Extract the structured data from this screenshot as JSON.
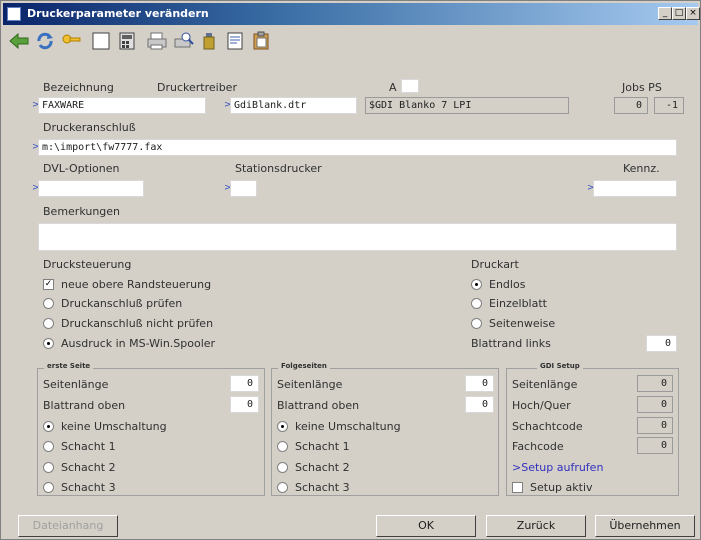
{
  "window": {
    "title": "Druckerparameter verändern"
  },
  "labels": {
    "bezeichnung": "Bezeichnung",
    "druckertreiber": "Druckertreiber",
    "a": "A",
    "jobs_ps": "Jobs PS",
    "druckeranschluss": "Druckeranschluß",
    "dvl_optionen": "DVL-Optionen",
    "stationsdrucker": "Stationsdrucker",
    "kennz": "Kennz.",
    "bemerkungen": "Bemerkungen",
    "drucksteuerung": "Drucksteuerung",
    "druckart": "Druckart",
    "blattrand_links": "Blattrand links"
  },
  "fields": {
    "bezeichnung": "FAXWARE",
    "druckertreiber": "GdiBlank.dtr",
    "treiber_name": "$GDI Blanko 7 LPI",
    "jobs": "0",
    "ps": "-1",
    "druckeranschluss": "m:\\import\\fw7777.fax",
    "dvl_optionen": "",
    "stationsdrucker": "",
    "kennz": "",
    "bemerkungen": "",
    "blattrand_links": "0"
  },
  "drucksteuerung": [
    {
      "type": "check",
      "label": "neue obere Randsteuerung",
      "checked": true
    },
    {
      "type": "radio",
      "label": "Druckanschluß prüfen",
      "checked": false
    },
    {
      "type": "radio",
      "label": "Druckanschluß nicht prüfen",
      "checked": false
    },
    {
      "type": "radio",
      "label": "Ausdruck in MS-Win.Spooler",
      "checked": true
    }
  ],
  "druckart": [
    {
      "label": "Endlos",
      "checked": true
    },
    {
      "label": "Einzelblatt",
      "checked": false
    },
    {
      "label": "Seitenweise",
      "checked": false
    }
  ],
  "erste_seite": {
    "title": "erste Seite",
    "seitenlaenge_label": "Seitenlänge",
    "seitenlaenge": "0",
    "blattrand_label": "Blattrand oben",
    "blattrand": "0",
    "options": [
      {
        "label": "keine Umschaltung",
        "checked": true
      },
      {
        "label": "Schacht 1",
        "checked": false
      },
      {
        "label": "Schacht 2",
        "checked": false
      },
      {
        "label": "Schacht 3",
        "checked": false
      }
    ]
  },
  "folgeseiten": {
    "title": "Folgeseiten",
    "seitenlaenge_label": "Seitenlänge",
    "seitenlaenge": "0",
    "blattrand_label": "Blattrand oben",
    "blattrand": "0",
    "options": [
      {
        "label": "keine Umschaltung",
        "checked": true
      },
      {
        "label": "Schacht 1",
        "checked": false
      },
      {
        "label": "Schacht 2",
        "checked": false
      },
      {
        "label": "Schacht 3",
        "checked": false
      }
    ]
  },
  "gdi_setup": {
    "title": "GDI Setup",
    "seitenlaenge_label": "Seitenlänge",
    "seitenlaenge": "0",
    "hochquer_label": "Hoch/Quer",
    "hochquer": "0",
    "schachtcode_label": "Schachtcode",
    "schachtcode": "0",
    "fachcode_label": "Fachcode",
    "fachcode": "0",
    "setup_link": ">Setup aufrufen",
    "setup_aktiv_label": "Setup aktiv",
    "setup_aktiv": false
  },
  "buttons": {
    "dateianhang": "Dateianhang",
    "ok": "OK",
    "zurueck": "Zurück",
    "uebernehmen": "Übernehmen"
  },
  "toolbar_icons": [
    "back-arrow-icon",
    "refresh-icon",
    "key-icon",
    "blank-page-icon",
    "calculator-icon",
    "printer-icon",
    "print-preview-icon",
    "bottle-icon",
    "document-icon",
    "clipboard-icon"
  ]
}
